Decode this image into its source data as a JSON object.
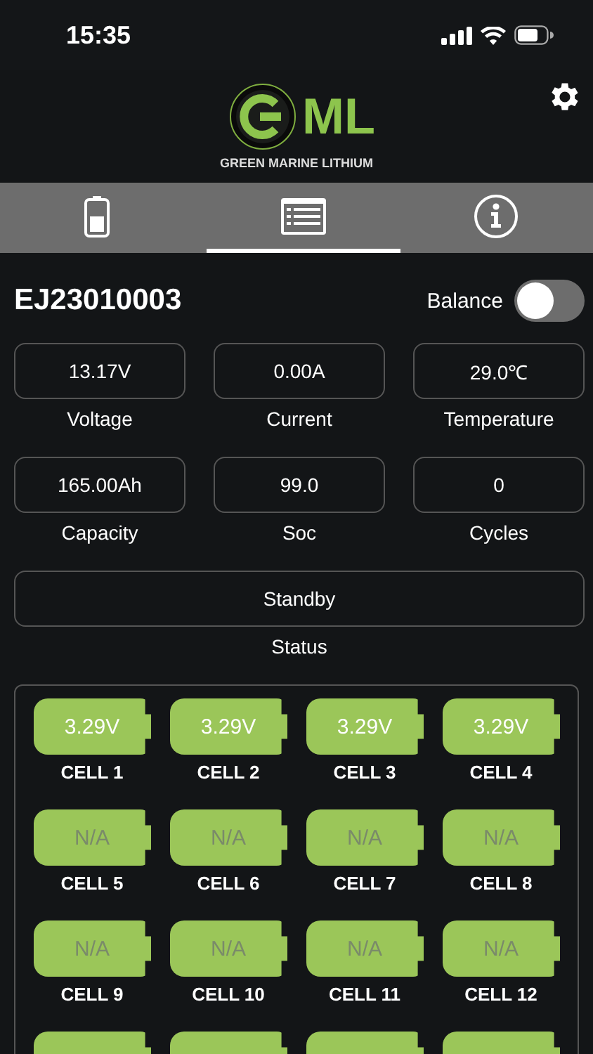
{
  "status_bar": {
    "time": "15:35"
  },
  "header": {
    "logo_mark": "ML",
    "logo_text": "GREEN MARINE LITHIUM"
  },
  "tabs": [
    {
      "kind": "battery",
      "selected": false
    },
    {
      "kind": "list",
      "selected": true
    },
    {
      "kind": "info",
      "selected": false
    }
  ],
  "device": {
    "serial": "EJ23010003",
    "balance": {
      "label": "Balance",
      "on": false
    }
  },
  "metrics": [
    {
      "value": "13.17V",
      "label": "Voltage"
    },
    {
      "value": "0.00A",
      "label": "Current"
    },
    {
      "value": "29.0℃",
      "label": "Temperature"
    },
    {
      "value": "165.00Ah",
      "label": "Capacity"
    },
    {
      "value": "99.0",
      "label": "Soc"
    },
    {
      "value": "0",
      "label": "Cycles"
    }
  ],
  "status": {
    "value": "Standby",
    "label": "Status"
  },
  "cells": [
    {
      "kind": "reading",
      "value": "3.29V",
      "label": "CELL 1"
    },
    {
      "kind": "reading",
      "value": "3.29V",
      "label": "CELL 2"
    },
    {
      "kind": "reading",
      "value": "3.29V",
      "label": "CELL 3"
    },
    {
      "kind": "reading",
      "value": "3.29V",
      "label": "CELL 4"
    },
    {
      "kind": "empty",
      "value": "N/A",
      "label": "CELL 5"
    },
    {
      "kind": "empty",
      "value": "N/A",
      "label": "CELL 6"
    },
    {
      "kind": "empty",
      "value": "N/A",
      "label": "CELL 7"
    },
    {
      "kind": "empty",
      "value": "N/A",
      "label": "CELL 8"
    },
    {
      "kind": "empty",
      "value": "N/A",
      "label": "CELL 9"
    },
    {
      "kind": "empty",
      "value": "N/A",
      "label": "CELL 10"
    },
    {
      "kind": "empty",
      "value": "N/A",
      "label": "CELL 11"
    },
    {
      "kind": "empty",
      "value": "N/A",
      "label": "CELL 12"
    },
    {
      "kind": "cutoff"
    },
    {
      "kind": "cutoff"
    },
    {
      "kind": "cutoff"
    },
    {
      "kind": "cutoff"
    }
  ]
}
